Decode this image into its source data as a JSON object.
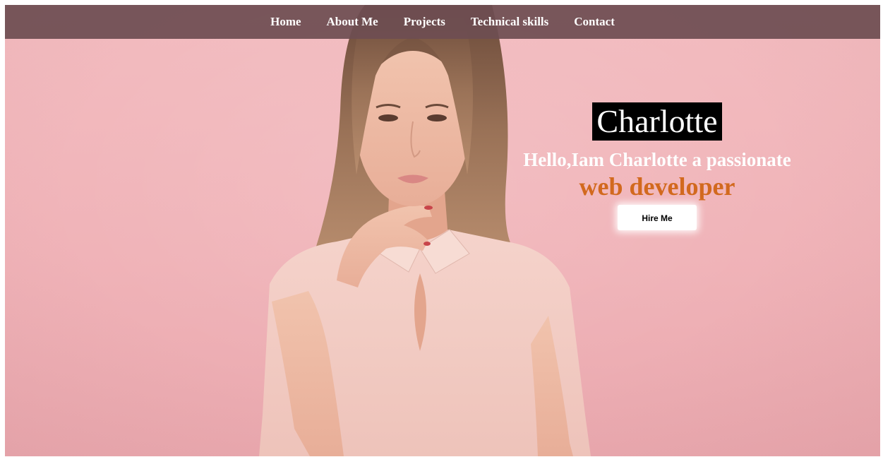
{
  "nav": {
    "items": [
      {
        "label": "Home"
      },
      {
        "label": "About Me"
      },
      {
        "label": "Projects"
      },
      {
        "label": "Technical skills"
      },
      {
        "label": "Contact"
      }
    ]
  },
  "hero": {
    "name": "Charlotte",
    "intro": "Hello,Iam Charlotte a passionate",
    "role": "web developer",
    "cta_label": "Hire Me"
  },
  "colors": {
    "background": "#f3bcc0",
    "navbar": "#6e4e52",
    "role_accent": "#d2691e",
    "name_box": "#000000"
  }
}
